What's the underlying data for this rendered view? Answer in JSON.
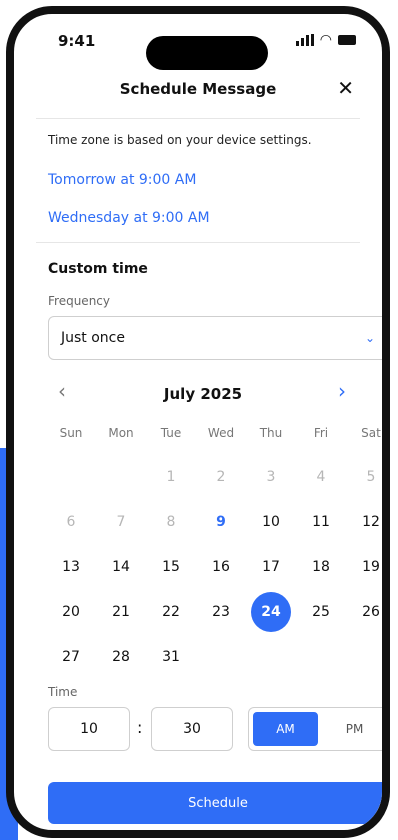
{
  "status": {
    "time": "9:41"
  },
  "header": {
    "title": "Schedule Message"
  },
  "timezone_note": "Time zone is based on your device settings.",
  "quick_options": [
    {
      "label": "Tomorrow at 9:00 AM"
    },
    {
      "label": "Wednesday at 9:00 AM"
    }
  ],
  "custom": {
    "title": "Custom time",
    "frequency_label": "Frequency",
    "frequency_value": "Just once"
  },
  "calendar": {
    "month_label": "July 2025",
    "weekdays": [
      "Sun",
      "Mon",
      "Tue",
      "Wed",
      "Thu",
      "Fri",
      "Sat"
    ],
    "dates": [
      "",
      "",
      "1",
      "2",
      "3",
      "4",
      "5",
      "6",
      "7",
      "8",
      "9",
      "10",
      "11",
      "12",
      "13",
      "14",
      "15",
      "16",
      "17",
      "18",
      "19",
      "20",
      "21",
      "22",
      "23",
      "24",
      "25",
      "26",
      "27",
      "28",
      "31"
    ],
    "today": "9",
    "selected": "24"
  },
  "time": {
    "label": "Time",
    "hour": "10",
    "separator": ":",
    "minute": "30",
    "am_label": "AM",
    "pm_label": "PM",
    "active_period": "AM"
  },
  "actions": {
    "schedule_label": "Schedule"
  },
  "colors": {
    "accent": "#2f6df6"
  }
}
